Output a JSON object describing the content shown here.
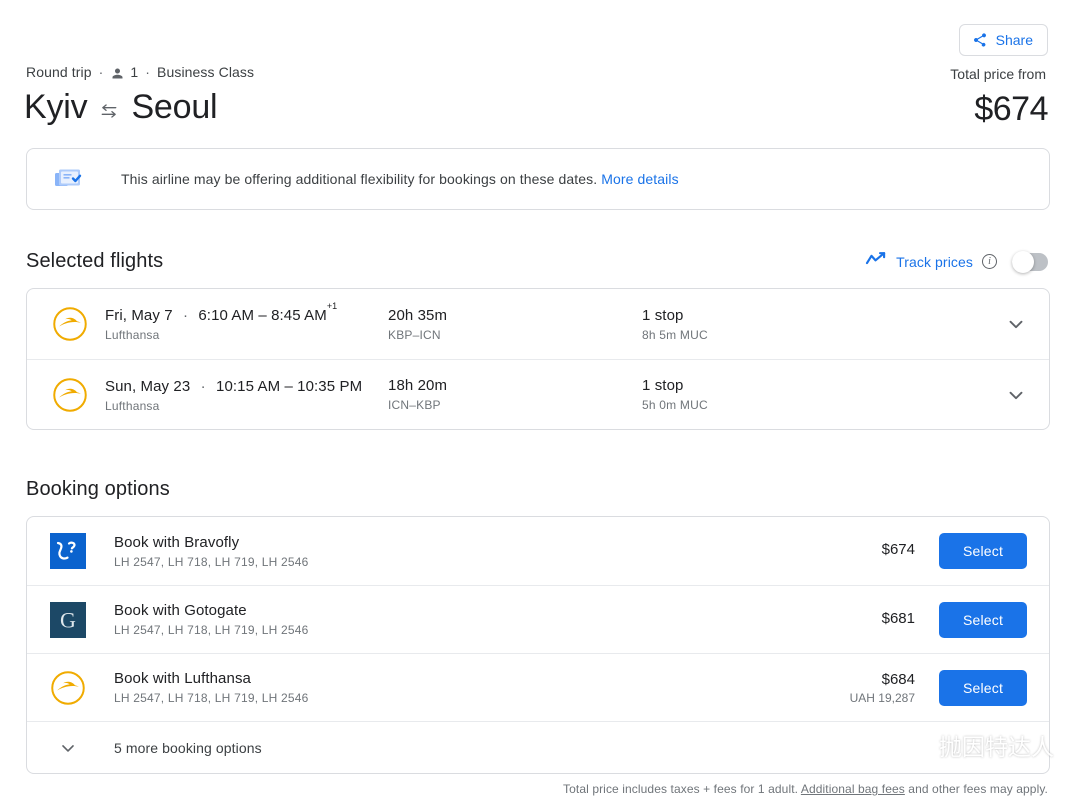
{
  "header": {
    "share_label": "Share",
    "trip_type": "Round trip",
    "passengers": "1",
    "cabin_class": "Business Class",
    "origin": "Kyiv",
    "destination": "Seoul",
    "total_price_label": "Total price from",
    "total_price": "$674"
  },
  "flex_banner": {
    "text": "This airline may be offering additional flexibility for bookings on these dates.",
    "link_label": "More details"
  },
  "selected_flights": {
    "section_title": "Selected flights",
    "track_prices_label": "Track prices",
    "track_prices_enabled": false,
    "rows": [
      {
        "airline": "Lufthansa",
        "date": "Fri, May 7",
        "times": "6:10 AM – 8:45 AM",
        "day_offset": "+1",
        "duration": "20h 35m",
        "route": "KBP–ICN",
        "stops": "1 stop",
        "layover": "8h 5m MUC"
      },
      {
        "airline": "Lufthansa",
        "date": "Sun, May 23",
        "times": "10:15 AM – 10:35 PM",
        "day_offset": "",
        "duration": "18h 20m",
        "route": "ICN–KBP",
        "stops": "1 stop",
        "layover": "5h 0m MUC"
      }
    ]
  },
  "booking_options": {
    "section_title": "Booking options",
    "select_label": "Select",
    "more_options_label": "5 more booking options",
    "rows": [
      {
        "title": "Book with Bravofly",
        "flights": "LH 2547, LH 718, LH 719, LH 2546",
        "price": "$674",
        "price_alt": "",
        "logo": "bravofly-logo"
      },
      {
        "title": "Book with Gotogate",
        "flights": "LH 2547, LH 718, LH 719, LH 2546",
        "price": "$681",
        "price_alt": "",
        "logo": "gotogate-logo"
      },
      {
        "title": "Book with Lufthansa",
        "flights": "LH 2547, LH 718, LH 719, LH 2546",
        "price": "$684",
        "price_alt": "UAH 19,287",
        "logo": "lufthansa-logo"
      }
    ]
  },
  "watermark": {
    "text": "抛因特达人"
  },
  "footer": {
    "prefix": "Total price includes taxes + fees for 1 adult.",
    "link": "Additional bag fees",
    "suffix": "and other fees may apply."
  },
  "colors": {
    "accent_blue": "#1a73e8",
    "lufthansa_yellow": "#f0ab00",
    "bravofly_blue": "#0b63ce",
    "gotogate_navy": "#1c4866",
    "text_primary": "#202124",
    "text_secondary": "#70757a",
    "border": "#dadce0"
  }
}
